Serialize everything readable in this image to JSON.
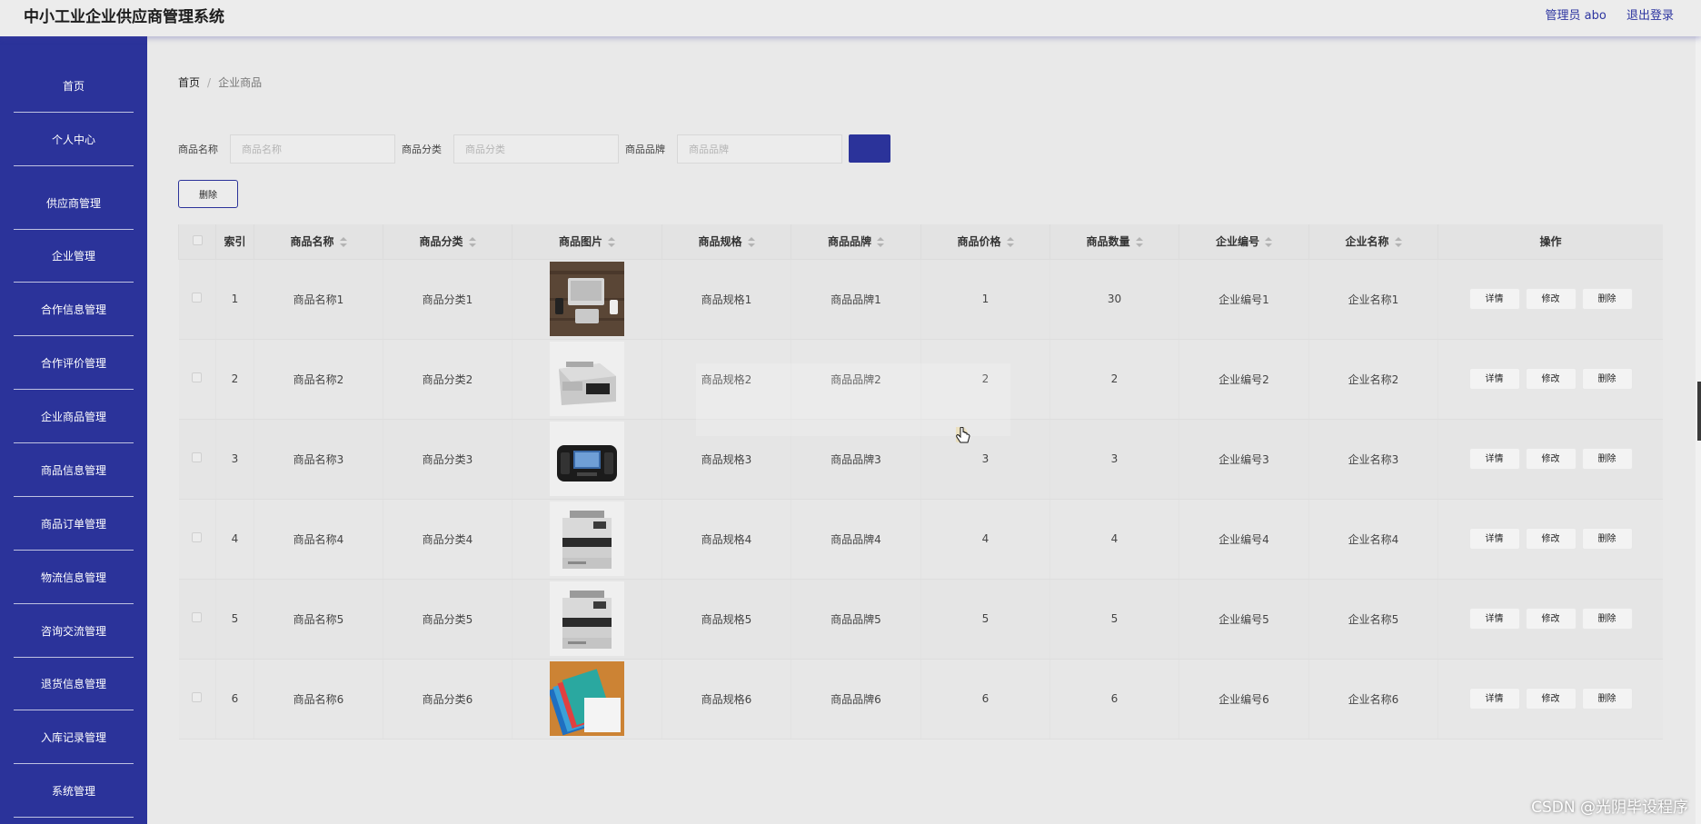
{
  "app": {
    "title": "中小工业企业供应商管理系统",
    "user": "管理员 abo",
    "logout": "退出登录"
  },
  "sidebar": {
    "items": [
      {
        "label": "首页"
      },
      {
        "label": "个人中心"
      },
      {
        "label": "供应商管理"
      },
      {
        "label": "企业管理"
      },
      {
        "label": "合作信息管理"
      },
      {
        "label": "合作评价管理"
      },
      {
        "label": "企业商品管理"
      },
      {
        "label": "商品信息管理"
      },
      {
        "label": "商品订单管理"
      },
      {
        "label": "物流信息管理"
      },
      {
        "label": "咨询交流管理"
      },
      {
        "label": "退货信息管理"
      },
      {
        "label": "入库记录管理"
      },
      {
        "label": "系统管理"
      }
    ]
  },
  "breadcrumb": {
    "home": "首页",
    "current": "企业商品"
  },
  "search": {
    "name_label": "商品名称",
    "name_placeholder": "商品名称",
    "category_label": "商品分类",
    "category_placeholder": "商品分类",
    "brand_label": "商品品牌",
    "brand_placeholder": "商品品牌"
  },
  "actions": {
    "delete": "删除"
  },
  "table": {
    "headers": {
      "index": "索引",
      "name": "商品名称",
      "category": "商品分类",
      "image": "商品图片",
      "spec": "商品规格",
      "brand": "商品品牌",
      "price": "商品价格",
      "quantity": "商品数量",
      "company_no": "企业编号",
      "company_name": "企业名称",
      "ops": "操作"
    },
    "op_labels": {
      "detail": "详情",
      "edit": "修改",
      "delete": "删除"
    },
    "rows": [
      {
        "index": "1",
        "name": "商品名称1",
        "category": "商品分类1",
        "image": "laptop-photo",
        "spec": "商品规格1",
        "brand": "商品品牌1",
        "price": "1",
        "quantity": "30",
        "company_no": "企业编号1",
        "company_name": "企业名称1"
      },
      {
        "index": "2",
        "name": "商品名称2",
        "category": "商品分类2",
        "image": "money-counter-photo",
        "spec": "商品规格2",
        "brand": "商品品牌2",
        "price": "2",
        "quantity": "2",
        "company_no": "企业编号2",
        "company_name": "企业名称2"
      },
      {
        "index": "3",
        "name": "商品名称3",
        "category": "商品分类3",
        "image": "pos-terminal-photo",
        "spec": "商品规格3",
        "brand": "商品品牌3",
        "price": "3",
        "quantity": "3",
        "company_no": "企业编号3",
        "company_name": "企业名称3"
      },
      {
        "index": "4",
        "name": "商品名称4",
        "category": "商品分类4",
        "image": "printer-photo",
        "spec": "商品规格4",
        "brand": "商品品牌4",
        "price": "4",
        "quantity": "4",
        "company_no": "企业编号4",
        "company_name": "企业名称4"
      },
      {
        "index": "5",
        "name": "商品名称5",
        "category": "商品分类5",
        "image": "printer-photo",
        "spec": "商品规格5",
        "brand": "商品品牌5",
        "price": "5",
        "quantity": "5",
        "company_no": "企业编号5",
        "company_name": "企业名称5"
      },
      {
        "index": "6",
        "name": "商品名称6",
        "category": "商品分类6",
        "image": "cards-photo",
        "spec": "商品规格6",
        "brand": "商品品牌6",
        "price": "6",
        "quantity": "6",
        "company_no": "企业编号6",
        "company_name": "企业名称6"
      }
    ]
  },
  "watermark": "CSDN @光阴毕设程序",
  "colors": {
    "primary": "#2b339a",
    "background": "#e9e9e9",
    "topbar": "#ececec"
  }
}
